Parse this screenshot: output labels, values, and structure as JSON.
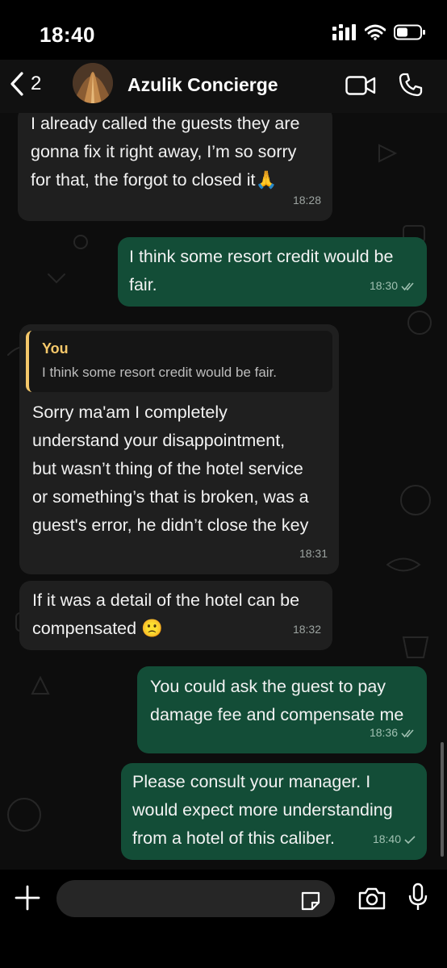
{
  "status_bar": {
    "time": "18:40"
  },
  "header": {
    "back_count": "2",
    "contact_name": "Azulik Concierge"
  },
  "messages": [
    {
      "dir": "in",
      "lines": [
        "I already called the guests they are",
        "gonna fix it right away, I’m so sorry",
        "for that, the forgot to closed it🙏"
      ],
      "time": "18:28"
    },
    {
      "dir": "out",
      "lines": [
        "I think some resort credit would be",
        "fair."
      ],
      "time": "18:30",
      "receipt": "read"
    },
    {
      "dir": "in",
      "quote": {
        "author": "You",
        "text": "I think some resort credit would be fair."
      },
      "lines": [
        "Sorry ma'am I completely",
        "understand your disappointment,",
        "but wasn’t thing of the hotel service",
        "or something’s that is broken, was a",
        "guest's error, he didn’t close the key"
      ],
      "time": "18:31"
    },
    {
      "dir": "in",
      "lines": [
        "If it was a detail of the hotel can be",
        "compensated 🙁"
      ],
      "time": "18:32"
    },
    {
      "dir": "out",
      "lines": [
        "You could ask the guest to pay",
        "damage fee and compensate me"
      ],
      "time": "18:36",
      "receipt": "read"
    },
    {
      "dir": "out",
      "lines": [
        "Please consult your manager. I",
        "would expect more understanding",
        "from a hotel of this caliber."
      ],
      "time": "18:40",
      "receipt": "sent"
    }
  ],
  "input_bar": {
    "placeholder": ""
  },
  "colors": {
    "incoming_bubble": "#1f1f1f",
    "outgoing_bubble": "#134d37",
    "quote_accent": "#f5c86a",
    "background": "#0d0d0d"
  },
  "icons": [
    "chevron-left-icon",
    "video-camera-icon",
    "phone-icon",
    "plus-icon",
    "sticker-icon",
    "camera-icon",
    "microphone-icon",
    "signal-icon",
    "wifi-icon",
    "battery-icon"
  ]
}
